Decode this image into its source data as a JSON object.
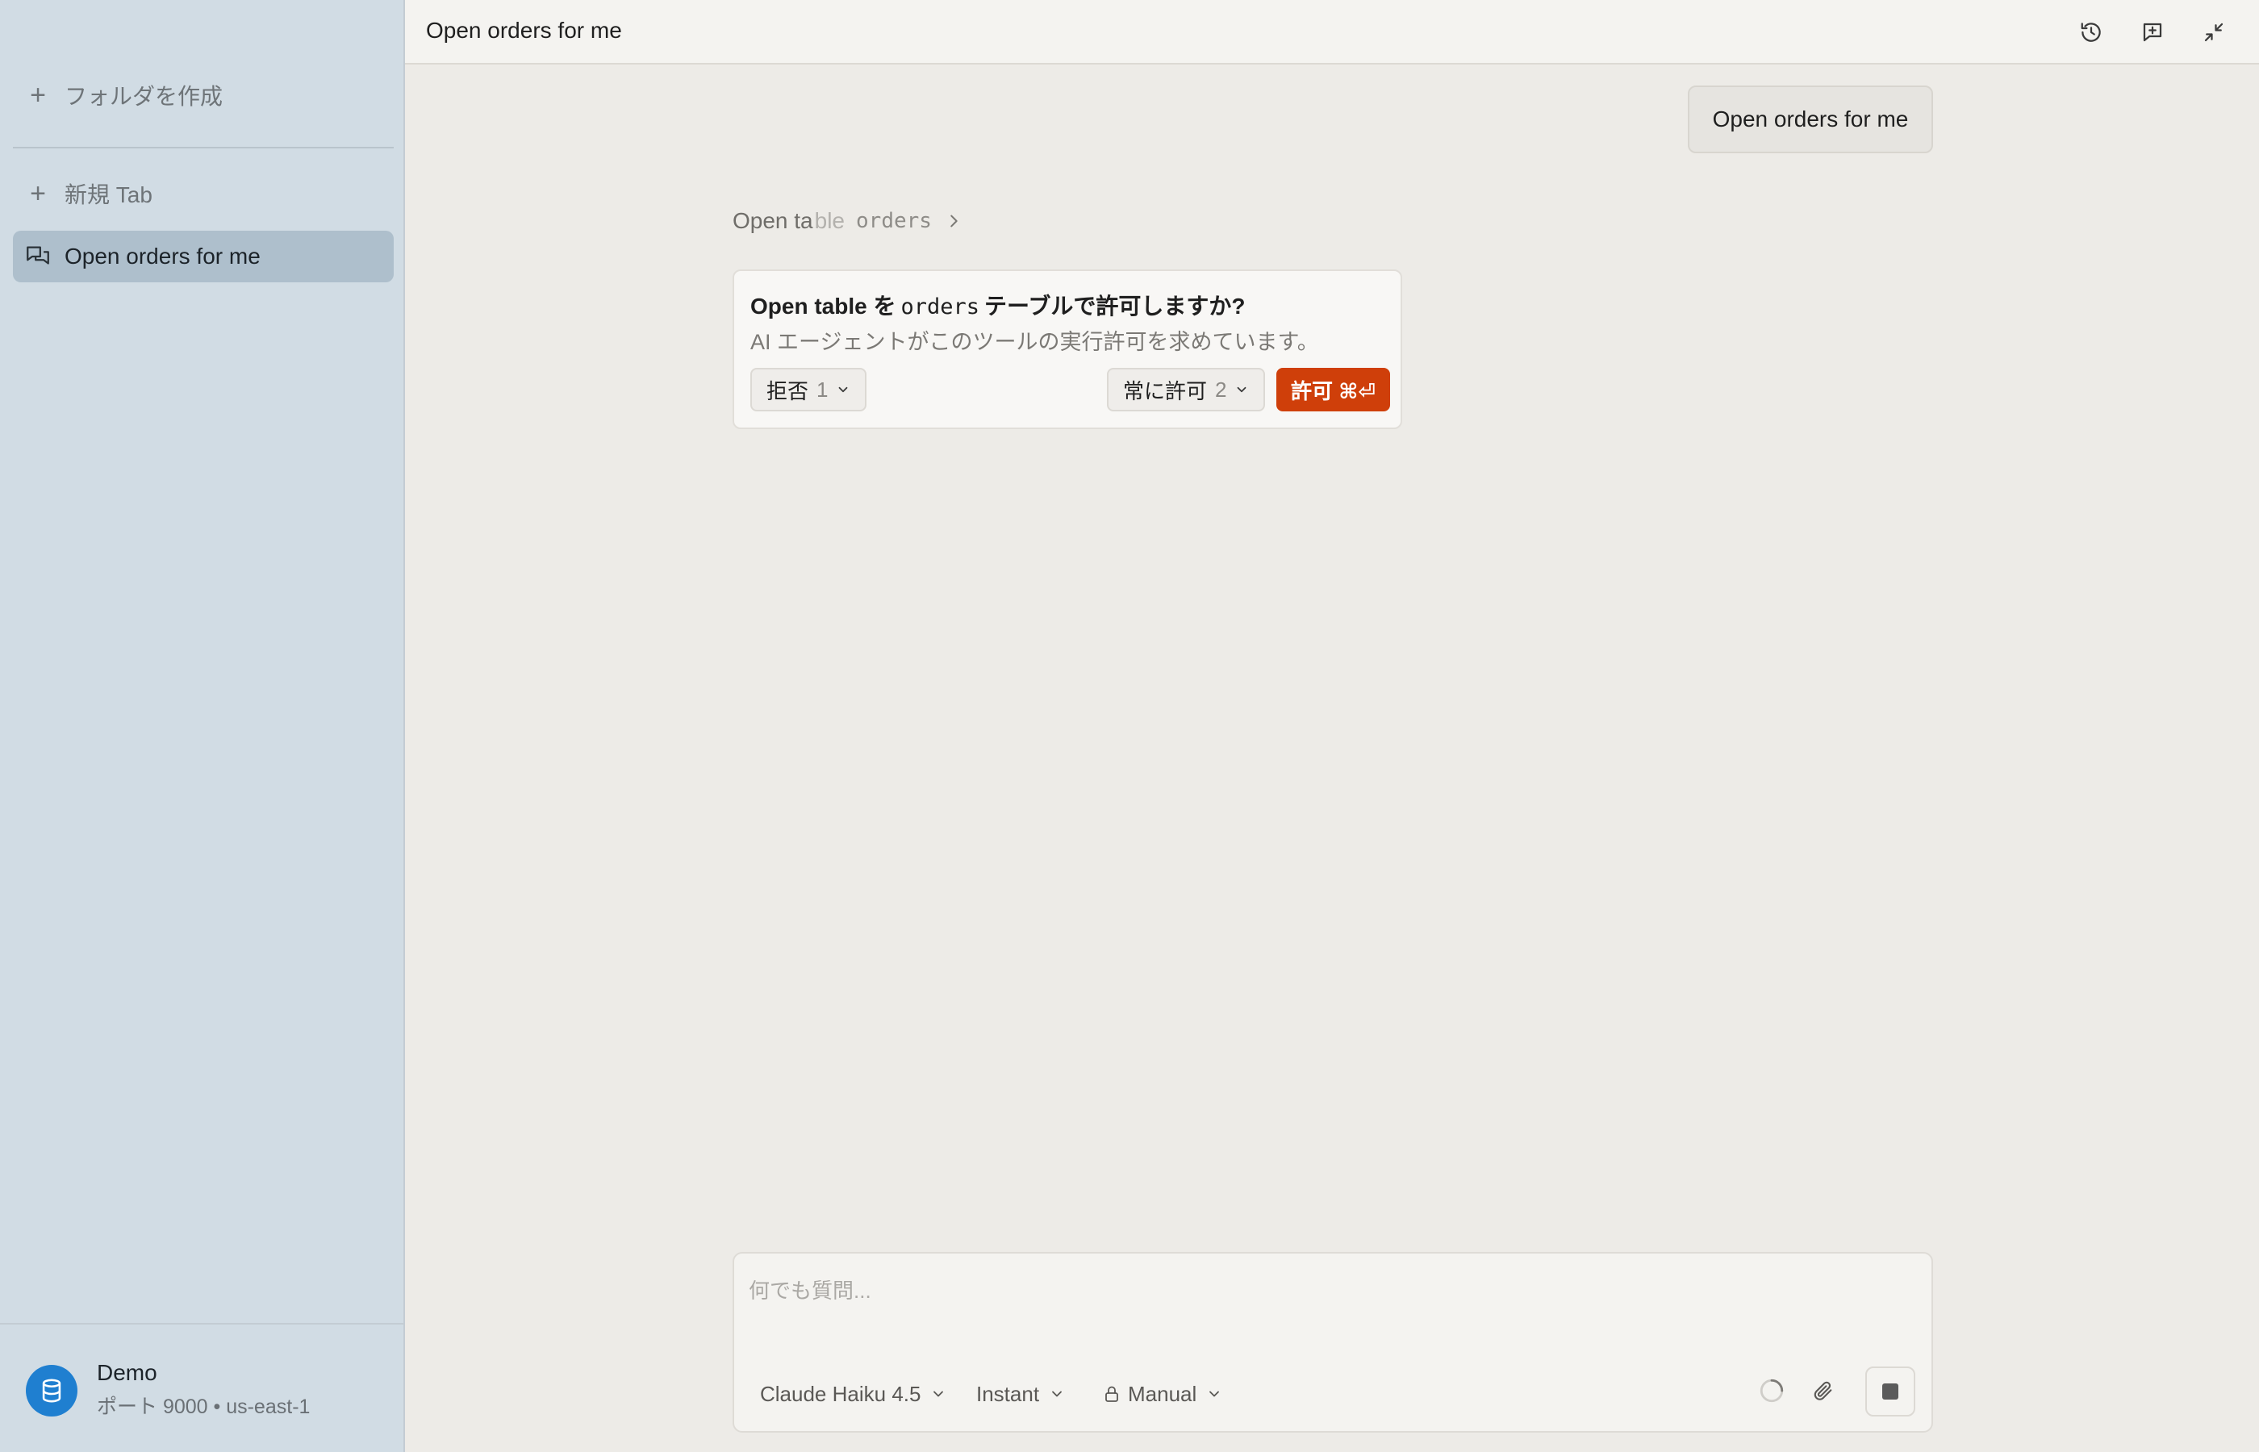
{
  "sidebar": {
    "create_folder_label": "フォルダを作成",
    "new_tab_label": "新規 Tab",
    "items": [
      {
        "label": "Open orders for me",
        "icon": "chat-bubbles-icon",
        "active": true
      }
    ],
    "connection": {
      "name": "Demo",
      "detail": "ポート 9000 • us-east-1",
      "icon": "database-icon",
      "color": "#1f7fd0"
    }
  },
  "header": {
    "title": "Open orders for me",
    "buttons": [
      "history-icon",
      "new-chat-icon",
      "collapse-icon"
    ]
  },
  "conversation": {
    "user_message": "Open orders for me",
    "tool_call": {
      "label_main": "Open ta",
      "label_faded": "ble",
      "argument": "orders"
    },
    "permission": {
      "title_prefix": "Open table を",
      "title_code": "orders",
      "title_suffix": "テーブルで許可しますか?",
      "description": "AI エージェントがこのツールの実行許可を求めています。",
      "deny_label": "拒否",
      "deny_key": "1",
      "always_label": "常に許可",
      "always_key": "2",
      "allow_label": "許可 ⌘⏎",
      "allow_color": "#cf3f0a"
    }
  },
  "composer": {
    "placeholder": "何でも質問...",
    "model": "Claude Haiku 4.5",
    "mode": "Instant",
    "approval": "Manual"
  }
}
